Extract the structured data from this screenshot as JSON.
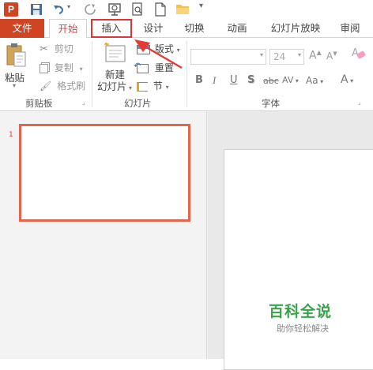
{
  "tabs": {
    "file": "文件",
    "home": "开始",
    "insert": "插入",
    "design": "设计",
    "transitions": "切换",
    "animations": "动画",
    "slideshow": "幻灯片放映",
    "review": "审阅"
  },
  "clipboard": {
    "paste": "粘贴",
    "cut": "剪切",
    "copy": "复制",
    "format_painter": "格式刷",
    "group": "剪贴板"
  },
  "slides": {
    "new_slide_line1": "新建",
    "new_slide_line2": "幻灯片",
    "layout": "版式",
    "reset": "重置",
    "section": "节",
    "group": "幻灯片"
  },
  "font": {
    "size": "24",
    "group": "字体",
    "bold": "B",
    "italic": "I",
    "underline": "U",
    "shadow": "S",
    "strikethrough": "abc",
    "spacing": "AV",
    "change_case": "Aa",
    "color": "A",
    "grow": "A",
    "shrink": "A"
  },
  "thumbnails": {
    "slide_number": "1"
  },
  "watermark": {
    "title": "百科全说",
    "subtitle": "助你轻松解决"
  },
  "colors": {
    "accent": "#d04423",
    "highlight": "#d9353b",
    "watermark": "#3aa34a"
  }
}
